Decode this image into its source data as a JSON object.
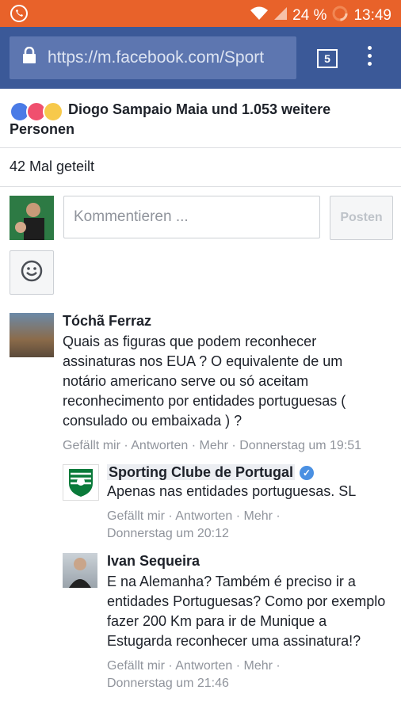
{
  "status_bar": {
    "battery": "24 %",
    "time": "13:49"
  },
  "browser": {
    "url": "https://m.facebook.com/Sport",
    "tab_count": "5"
  },
  "reactions": {
    "text": "Diogo Sampaio Maia und 1.053 weitere Personen"
  },
  "shares": {
    "text": "42 Mal geteilt"
  },
  "composer": {
    "placeholder": "Kommentieren ...",
    "post_label": "Posten"
  },
  "comments": [
    {
      "author": "Tóchã Ferraz",
      "text": "Quais as figuras que podem reconhecer assinaturas nos EUA ? O equivalente de um notário americano serve ou só aceitam reconhecimento por entidades portuguesas ( consulado ou embaixada ) ?",
      "like": "Gefällt mir",
      "reply": "Antworten",
      "more": "Mehr",
      "time": "Donnerstag um 19:51"
    },
    {
      "author": "Sporting Clube de Portugal",
      "text": "Apenas nas entidades portuguesas. SL",
      "like": "Gefällt mir",
      "reply": "Antworten",
      "more": "Mehr",
      "time": "Donnerstag um 20:12"
    },
    {
      "author": "Ivan Sequeira",
      "text": "E na Alemanha? Também é preciso ir a entidades Portuguesas? Como por exemplo fazer 200 Km para ir de Munique a Estugarda reconhecer uma assinatura!?",
      "like": "Gefällt mir",
      "reply": "Antworten",
      "more": "Mehr",
      "time": "Donnerstag um 21:46"
    }
  ],
  "colors": {
    "status_bar": "#e8622a",
    "facebook_blue": "#3b5998",
    "meta_text": "#90949c"
  }
}
